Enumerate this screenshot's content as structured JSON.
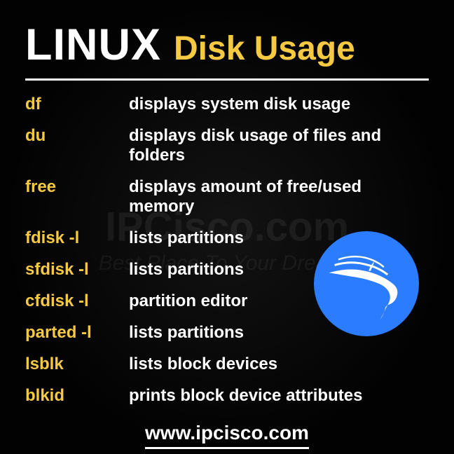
{
  "header": {
    "title_main": "LINUX",
    "title_sub": "Disk Usage"
  },
  "commands": [
    {
      "cmd": "df",
      "desc": "displays system disk usage"
    },
    {
      "cmd": "du",
      "desc": "displays disk usage of files and folders"
    },
    {
      "cmd": "free",
      "desc": "displays amount of free/used memory"
    },
    {
      "cmd": "fdisk -l",
      "desc": "lists partitions"
    },
    {
      "cmd": "sfdisk -l",
      "desc": "lists partitions"
    },
    {
      "cmd": "cfdisk -l",
      "desc": "partition editor"
    },
    {
      "cmd": "parted -l",
      "desc": "lists partitions"
    },
    {
      "cmd": "lsblk",
      "desc": "lists block devices"
    },
    {
      "cmd": "blkid",
      "desc": "prints block device attributes"
    }
  ],
  "footer": {
    "url": "www.ipcisco.com"
  },
  "watermark": {
    "main": "IPCisco.com",
    "sub": "Best Place To Your Dreams"
  },
  "colors": {
    "accent": "#f5c942",
    "logo_bg": "#2b7cff",
    "text": "#ffffff"
  }
}
